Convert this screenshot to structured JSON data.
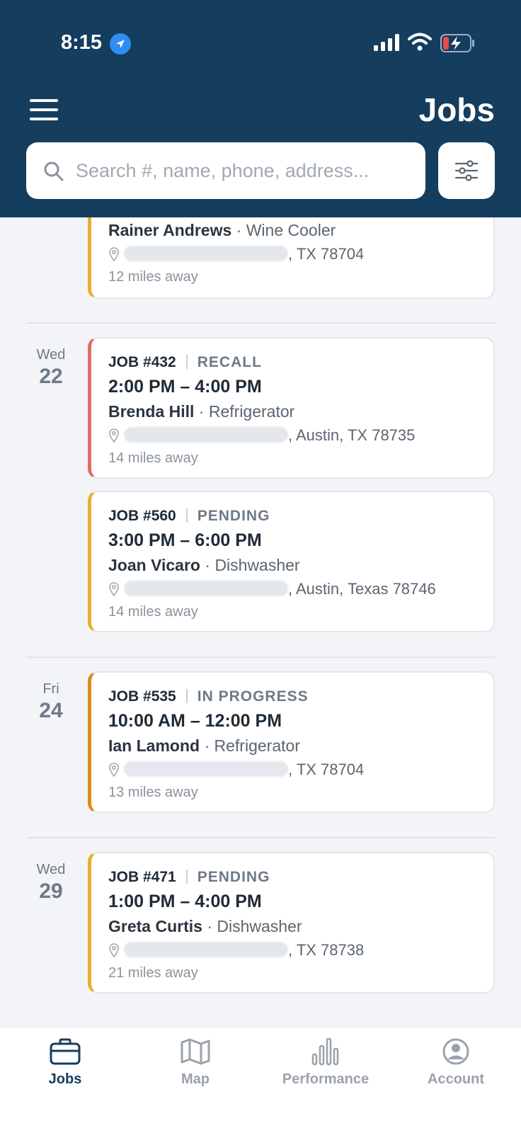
{
  "status_bar": {
    "time": "8:15"
  },
  "header": {
    "title": "Jobs",
    "search_placeholder": "Search #, name, phone, address..."
  },
  "partial_card": {
    "name": "Rainer Andrews",
    "appliance": "Wine Cooler",
    "address_suffix": ", TX 78704",
    "distance": "12 miles away"
  },
  "groups": [
    {
      "dow": "Wed",
      "day": "22",
      "jobs": [
        {
          "job": "JOB #432",
          "status": "RECALL",
          "time": "2:00 PM – 4:00 PM",
          "name": "Brenda Hill",
          "appliance": "Refrigerator",
          "address_suffix": ", Austin, TX 78735",
          "distance": "14 miles away",
          "accent": "#e36b6b"
        },
        {
          "job": "JOB #560",
          "status": "PENDING",
          "time": "3:00 PM – 6:00 PM",
          "name": "Joan Vicaro",
          "appliance": "Dishwasher",
          "address_suffix": ", Austin, Texas 78746",
          "distance": "14 miles away",
          "accent": "#e8b02a"
        }
      ]
    },
    {
      "dow": "Fri",
      "day": "24",
      "jobs": [
        {
          "job": "JOB #535",
          "status": "IN PROGRESS",
          "time": "10:00 AM – 12:00 PM",
          "name": "Ian Lamond",
          "appliance": "Refrigerator",
          "address_suffix": ", TX 78704",
          "distance": "13 miles away",
          "accent": "#dd8a16"
        }
      ]
    },
    {
      "dow": "Wed",
      "day": "29",
      "jobs": [
        {
          "job": "JOB #471",
          "status": "PENDING",
          "time": "1:00 PM – 4:00 PM",
          "name": "Greta Curtis",
          "appliance": "Dishwasher",
          "address_suffix": ", TX 78738",
          "distance": "21 miles away",
          "accent": "#e8b02a"
        }
      ]
    }
  ],
  "tabs": [
    {
      "label": "Jobs",
      "icon": "briefcase-icon",
      "active": true
    },
    {
      "label": "Map",
      "icon": "map-icon",
      "active": false
    },
    {
      "label": "Performance",
      "icon": "bar-chart-icon",
      "active": false
    },
    {
      "label": "Account",
      "icon": "user-circle-icon",
      "active": false
    }
  ],
  "colors": {
    "header_bg": "#143d5e",
    "pending": "#e8b02a",
    "recall": "#e36b6b",
    "in_progress": "#dd8a16"
  }
}
